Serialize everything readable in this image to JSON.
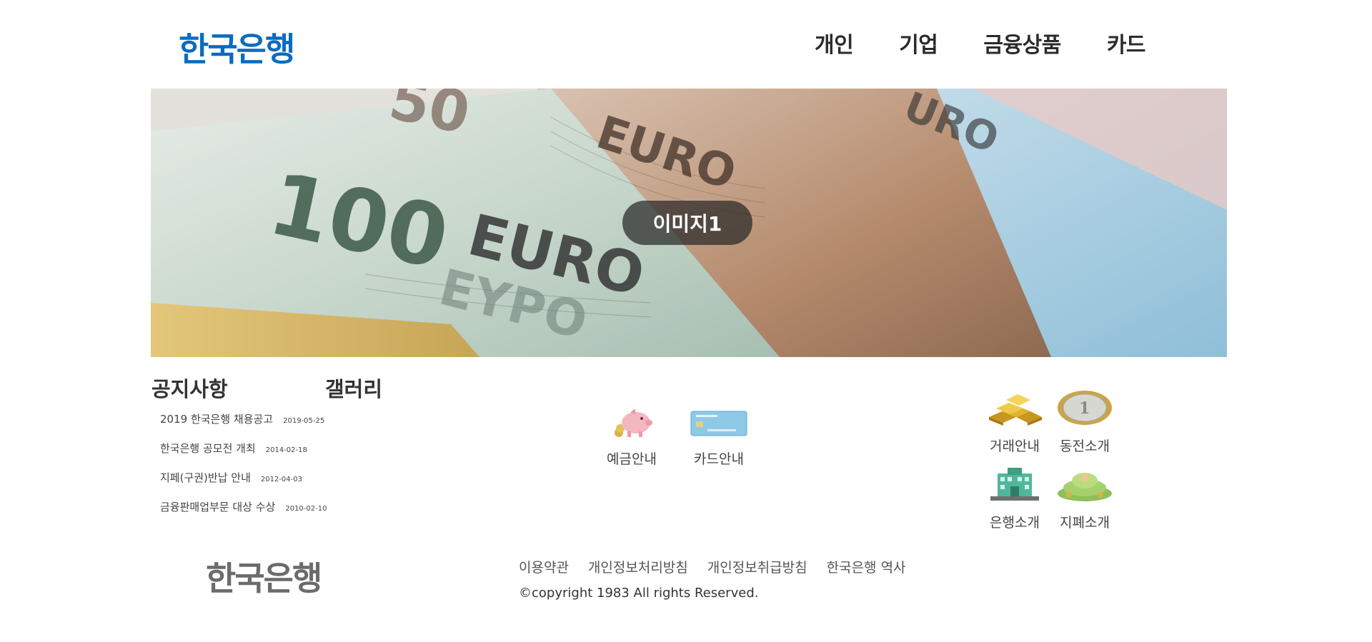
{
  "header": {
    "logo": "한국은행",
    "nav": [
      "개인",
      "기업",
      "금융상품",
      "카드"
    ]
  },
  "banner": {
    "caption": "이미지1"
  },
  "tabs": {
    "notice": "공지사항",
    "gallery": "갤러리"
  },
  "notices": [
    {
      "title": "2019 한국은행 채용공고",
      "date": "2019-05-25"
    },
    {
      "title": "한국은행 공모전 개최",
      "date": "2014-02-18"
    },
    {
      "title": "지페(구권)반납 안내",
      "date": "2012-04-03"
    },
    {
      "title": "금융판매업부문 대상 수상",
      "date": "2010-02-10"
    }
  ],
  "quick_links": {
    "deposit": "예금안내",
    "card": "카드안내",
    "trade": "거래안내",
    "coin": "동전소개",
    "bank": "은행소개",
    "bill": "지폐소개"
  },
  "footer": {
    "logo": "한국은행",
    "links": [
      "이용약관",
      "개인정보처리방침",
      "개인정보취급방침",
      "한국은행 역사"
    ],
    "copyright": "©copyright 1983 All rights Reserved."
  },
  "colors": {
    "brand": "#0a6cc0",
    "footer_logo": "#6b6b6b"
  }
}
